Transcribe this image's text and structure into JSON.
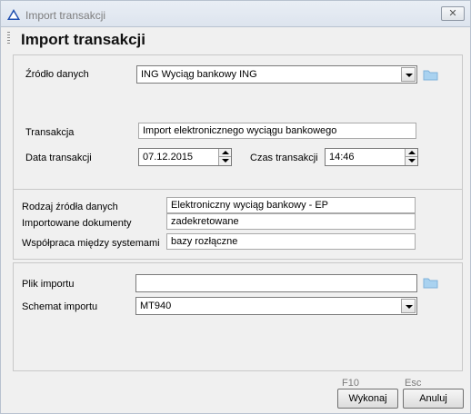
{
  "window": {
    "title": "Import transakcji"
  },
  "header": {
    "title": "Import transakcji"
  },
  "source": {
    "label": "Źródło danych",
    "value": "ING Wyciąg bankowy ING"
  },
  "transaction": {
    "label": "Transakcja",
    "value": "Import elektronicznego wyciągu bankowego",
    "date_label": "Data transakcji",
    "date_value": "07.12.2015",
    "time_label": "Czas transakcji",
    "time_value": "14:46"
  },
  "info": {
    "type_label": "Rodzaj źródła danych",
    "type_value": "Elektroniczny wyciąg bankowy - EP",
    "docs_label": "Importowane dokumenty",
    "docs_value": "zadekretowane",
    "coop_label": "Współpraca między systemami",
    "coop_value": "bazy rozłączne"
  },
  "import": {
    "file_label": "Plik importu",
    "file_value": "",
    "schema_label": "Schemat importu",
    "schema_value": "MT940"
  },
  "buttons": {
    "execute_label": "Wykonaj",
    "execute_key": "F10",
    "cancel_label": "Anuluj",
    "cancel_key": "Esc"
  },
  "icons": {
    "app": "app-triangle-icon",
    "close": "close-icon",
    "folder": "folder-icon"
  },
  "colors": {
    "folder": "#a9d2f0",
    "app_icon": "#1f4fb0"
  }
}
